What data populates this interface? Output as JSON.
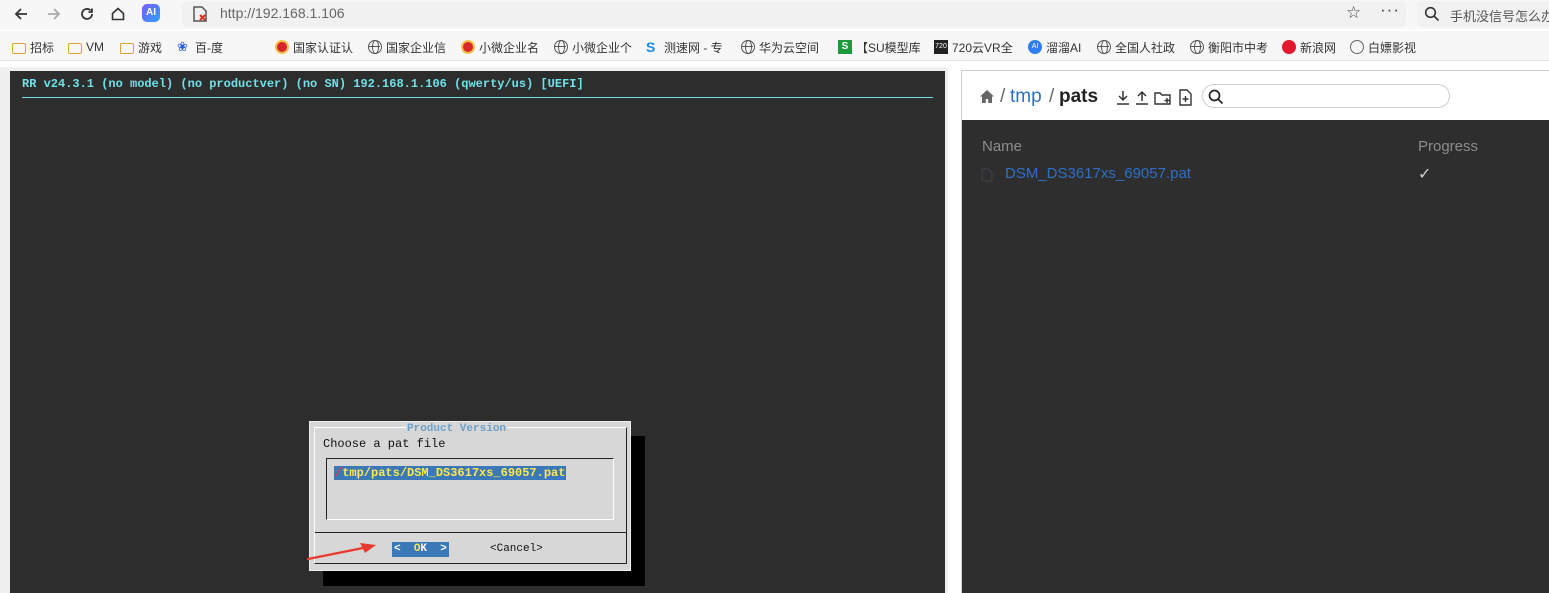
{
  "browser": {
    "url": "http://192.168.1.106",
    "ai_badge": "AI",
    "search_text": "手机没信号怎么办",
    "bookmarks": [
      {
        "label": "招标",
        "icon": "folder-icon"
      },
      {
        "label": "VM",
        "icon": "folder-icon"
      },
      {
        "label": "游戏",
        "icon": "folder-icon"
      },
      {
        "label": "百-度",
        "icon": "baidu-icon"
      },
      {
        "label": "国家认证认",
        "icon": "emblem-icon"
      },
      {
        "label": "国家企业信",
        "icon": "globe-icon"
      },
      {
        "label": "小微企业名",
        "icon": "emblem-icon"
      },
      {
        "label": "小微企业个",
        "icon": "globe-icon"
      },
      {
        "label": "测速网 - 专",
        "icon": "speedtest-icon"
      },
      {
        "label": "华为云空间",
        "icon": "globe-icon"
      },
      {
        "label": "【SU模型库",
        "icon": "su-icon"
      },
      {
        "label": "720云VR全",
        "icon": "720-icon"
      },
      {
        "label": "溜溜AI",
        "icon": "liuliu-icon"
      },
      {
        "label": "全国人社政",
        "icon": "globe-icon"
      },
      {
        "label": "衡阳市中考",
        "icon": "globe-icon"
      },
      {
        "label": "新浪网",
        "icon": "weibo-icon"
      },
      {
        "label": "白嫖影视",
        "icon": "film-icon"
      }
    ]
  },
  "terminal": {
    "header": "RR v24.3.1 (no model) (no productver) (no SN) 192.168.1.106 (qwerty/us) [UEFI]",
    "dialog": {
      "title": "Product Version",
      "prompt": "Choose a pat file",
      "cursor": "/",
      "input_value": "tmp/pats/DSM_DS3617xs_69057.pat",
      "ok_left": "<  ",
      "ok_hot": "O",
      "ok_rest": "K  >",
      "cancel_label": "<Cancel>"
    }
  },
  "filebrowser": {
    "crumb_sep": "/",
    "crumb_parent": "tmp",
    "crumb_current": "pats",
    "columns": {
      "name": "Name",
      "progress": "Progress"
    },
    "files": [
      {
        "name": "DSM_DS3617xs_69057.pat",
        "progress": "✓"
      }
    ]
  },
  "colors": {
    "terminal_bg": "#2d2d2d",
    "terminal_text": "#6fe2e8",
    "dialog_bg": "#d7d7d7",
    "highlight_bg": "#3a78b8",
    "highlight_text": "#ffe84d",
    "link": "#2f6fc4",
    "annotation_arrow": "#e83a2e"
  }
}
